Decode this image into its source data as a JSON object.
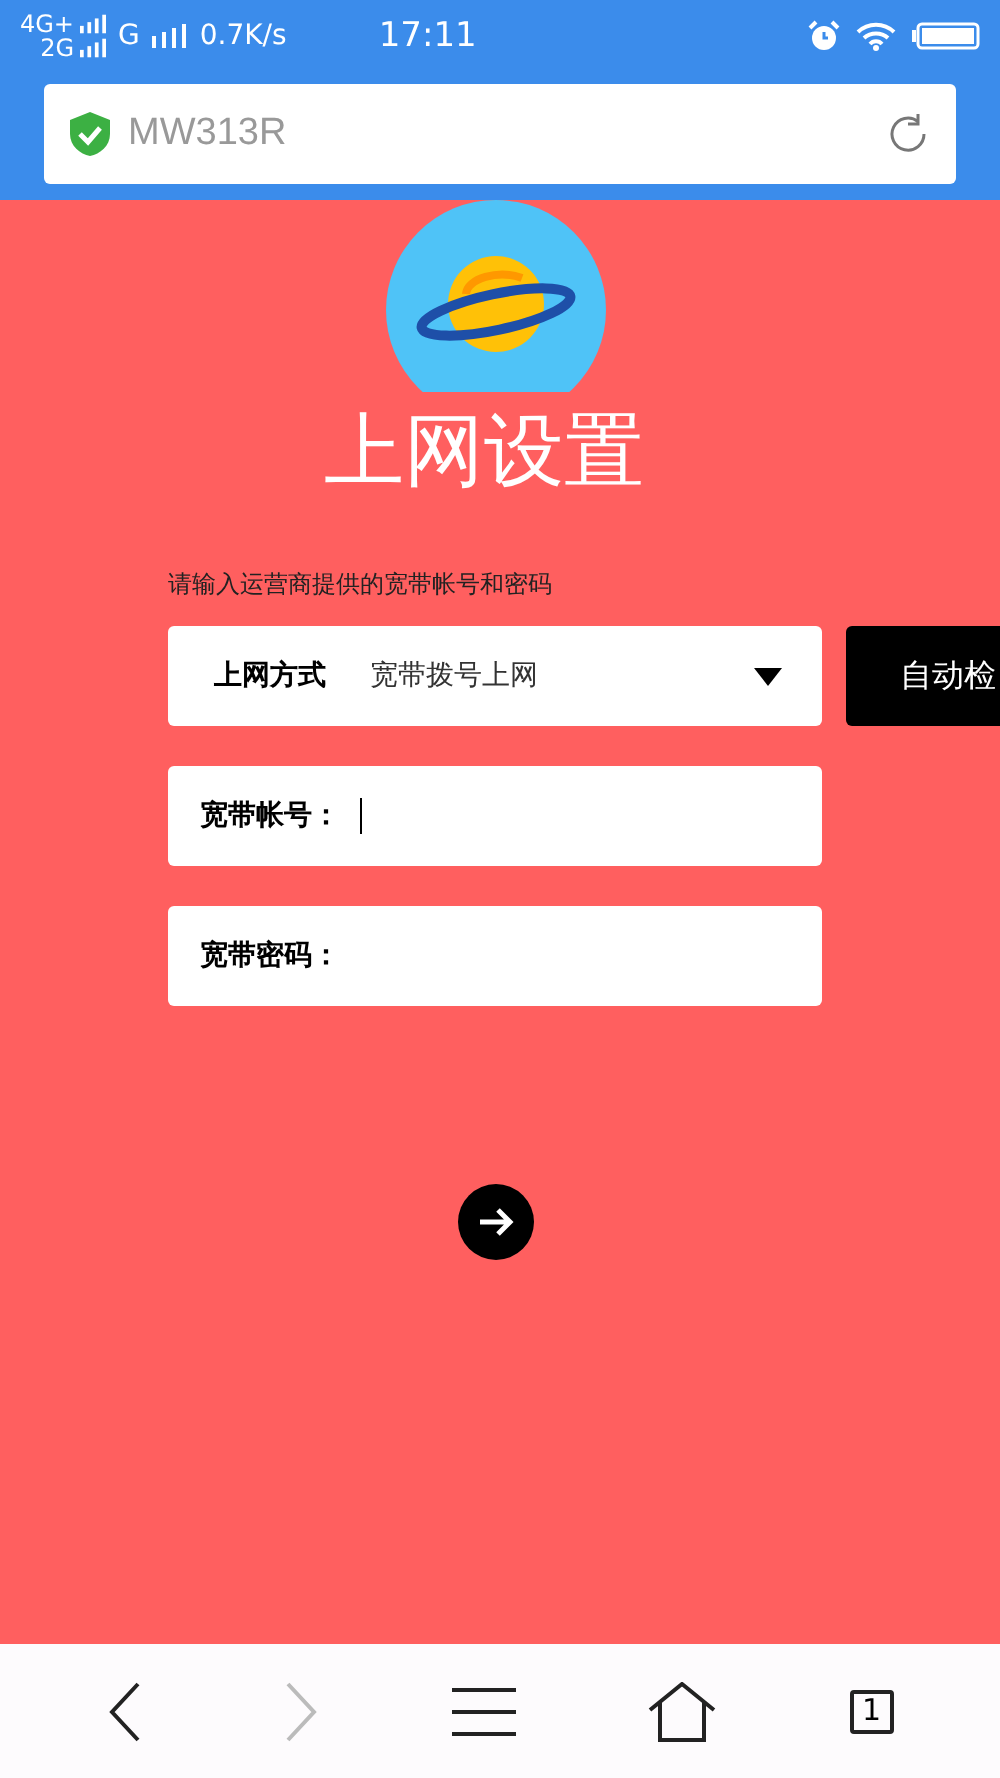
{
  "status_bar": {
    "network_1": "4G+",
    "network_2": "2G",
    "network_3": "G",
    "speed": "0.7K/s",
    "time": "17:11"
  },
  "address_bar": {
    "url": "MW313R"
  },
  "page": {
    "title": "上网设置",
    "hint": "请输入运营商提供的宽带帐号和密码",
    "connection": {
      "label": "上网方式",
      "value": "宽带拨号上网"
    },
    "detect_button": "自动检",
    "fields": [
      {
        "label": "宽带帐号：",
        "focused": true
      },
      {
        "label": "宽带密码：",
        "focused": false
      }
    ]
  },
  "toolbar": {
    "back_disabled": false,
    "forward_disabled": true,
    "tab_count": "1"
  }
}
